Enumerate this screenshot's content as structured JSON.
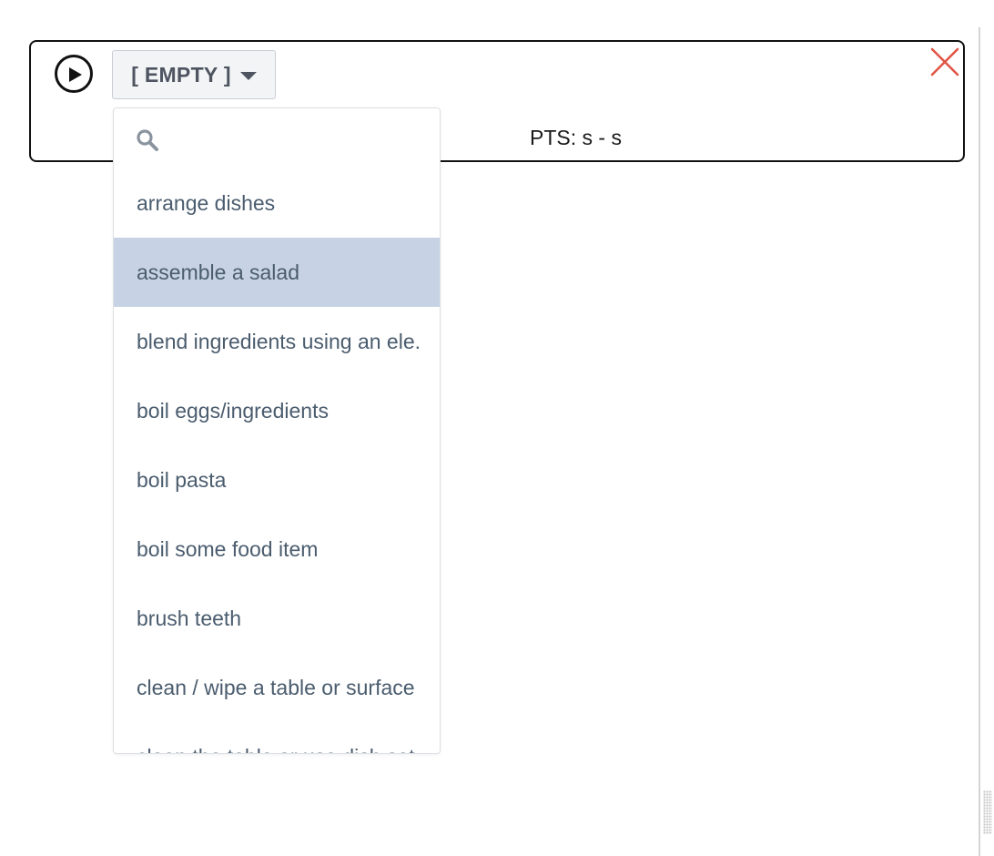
{
  "segment": {
    "label_value": "[ EMPTY ]",
    "pts_text": "PTS: s - s"
  },
  "dropdown": {
    "search_placeholder": "",
    "highlighted_index": 1,
    "options": [
      "arrange dishes",
      "assemble a salad",
      "blend ingredients using an ele.",
      "boil eggs/ingredients",
      "boil pasta",
      "boil some food item",
      "brush teeth",
      "clean / wipe a table or surface",
      "clean the table or use dish set"
    ]
  },
  "colors": {
    "highlight": "#c7d3e4",
    "close": "#e05545",
    "option_text": "#4a5c6e"
  },
  "icons": {
    "play": "play-circle-icon",
    "caret": "caret-down-icon",
    "search": "search-icon",
    "close": "close-icon"
  }
}
